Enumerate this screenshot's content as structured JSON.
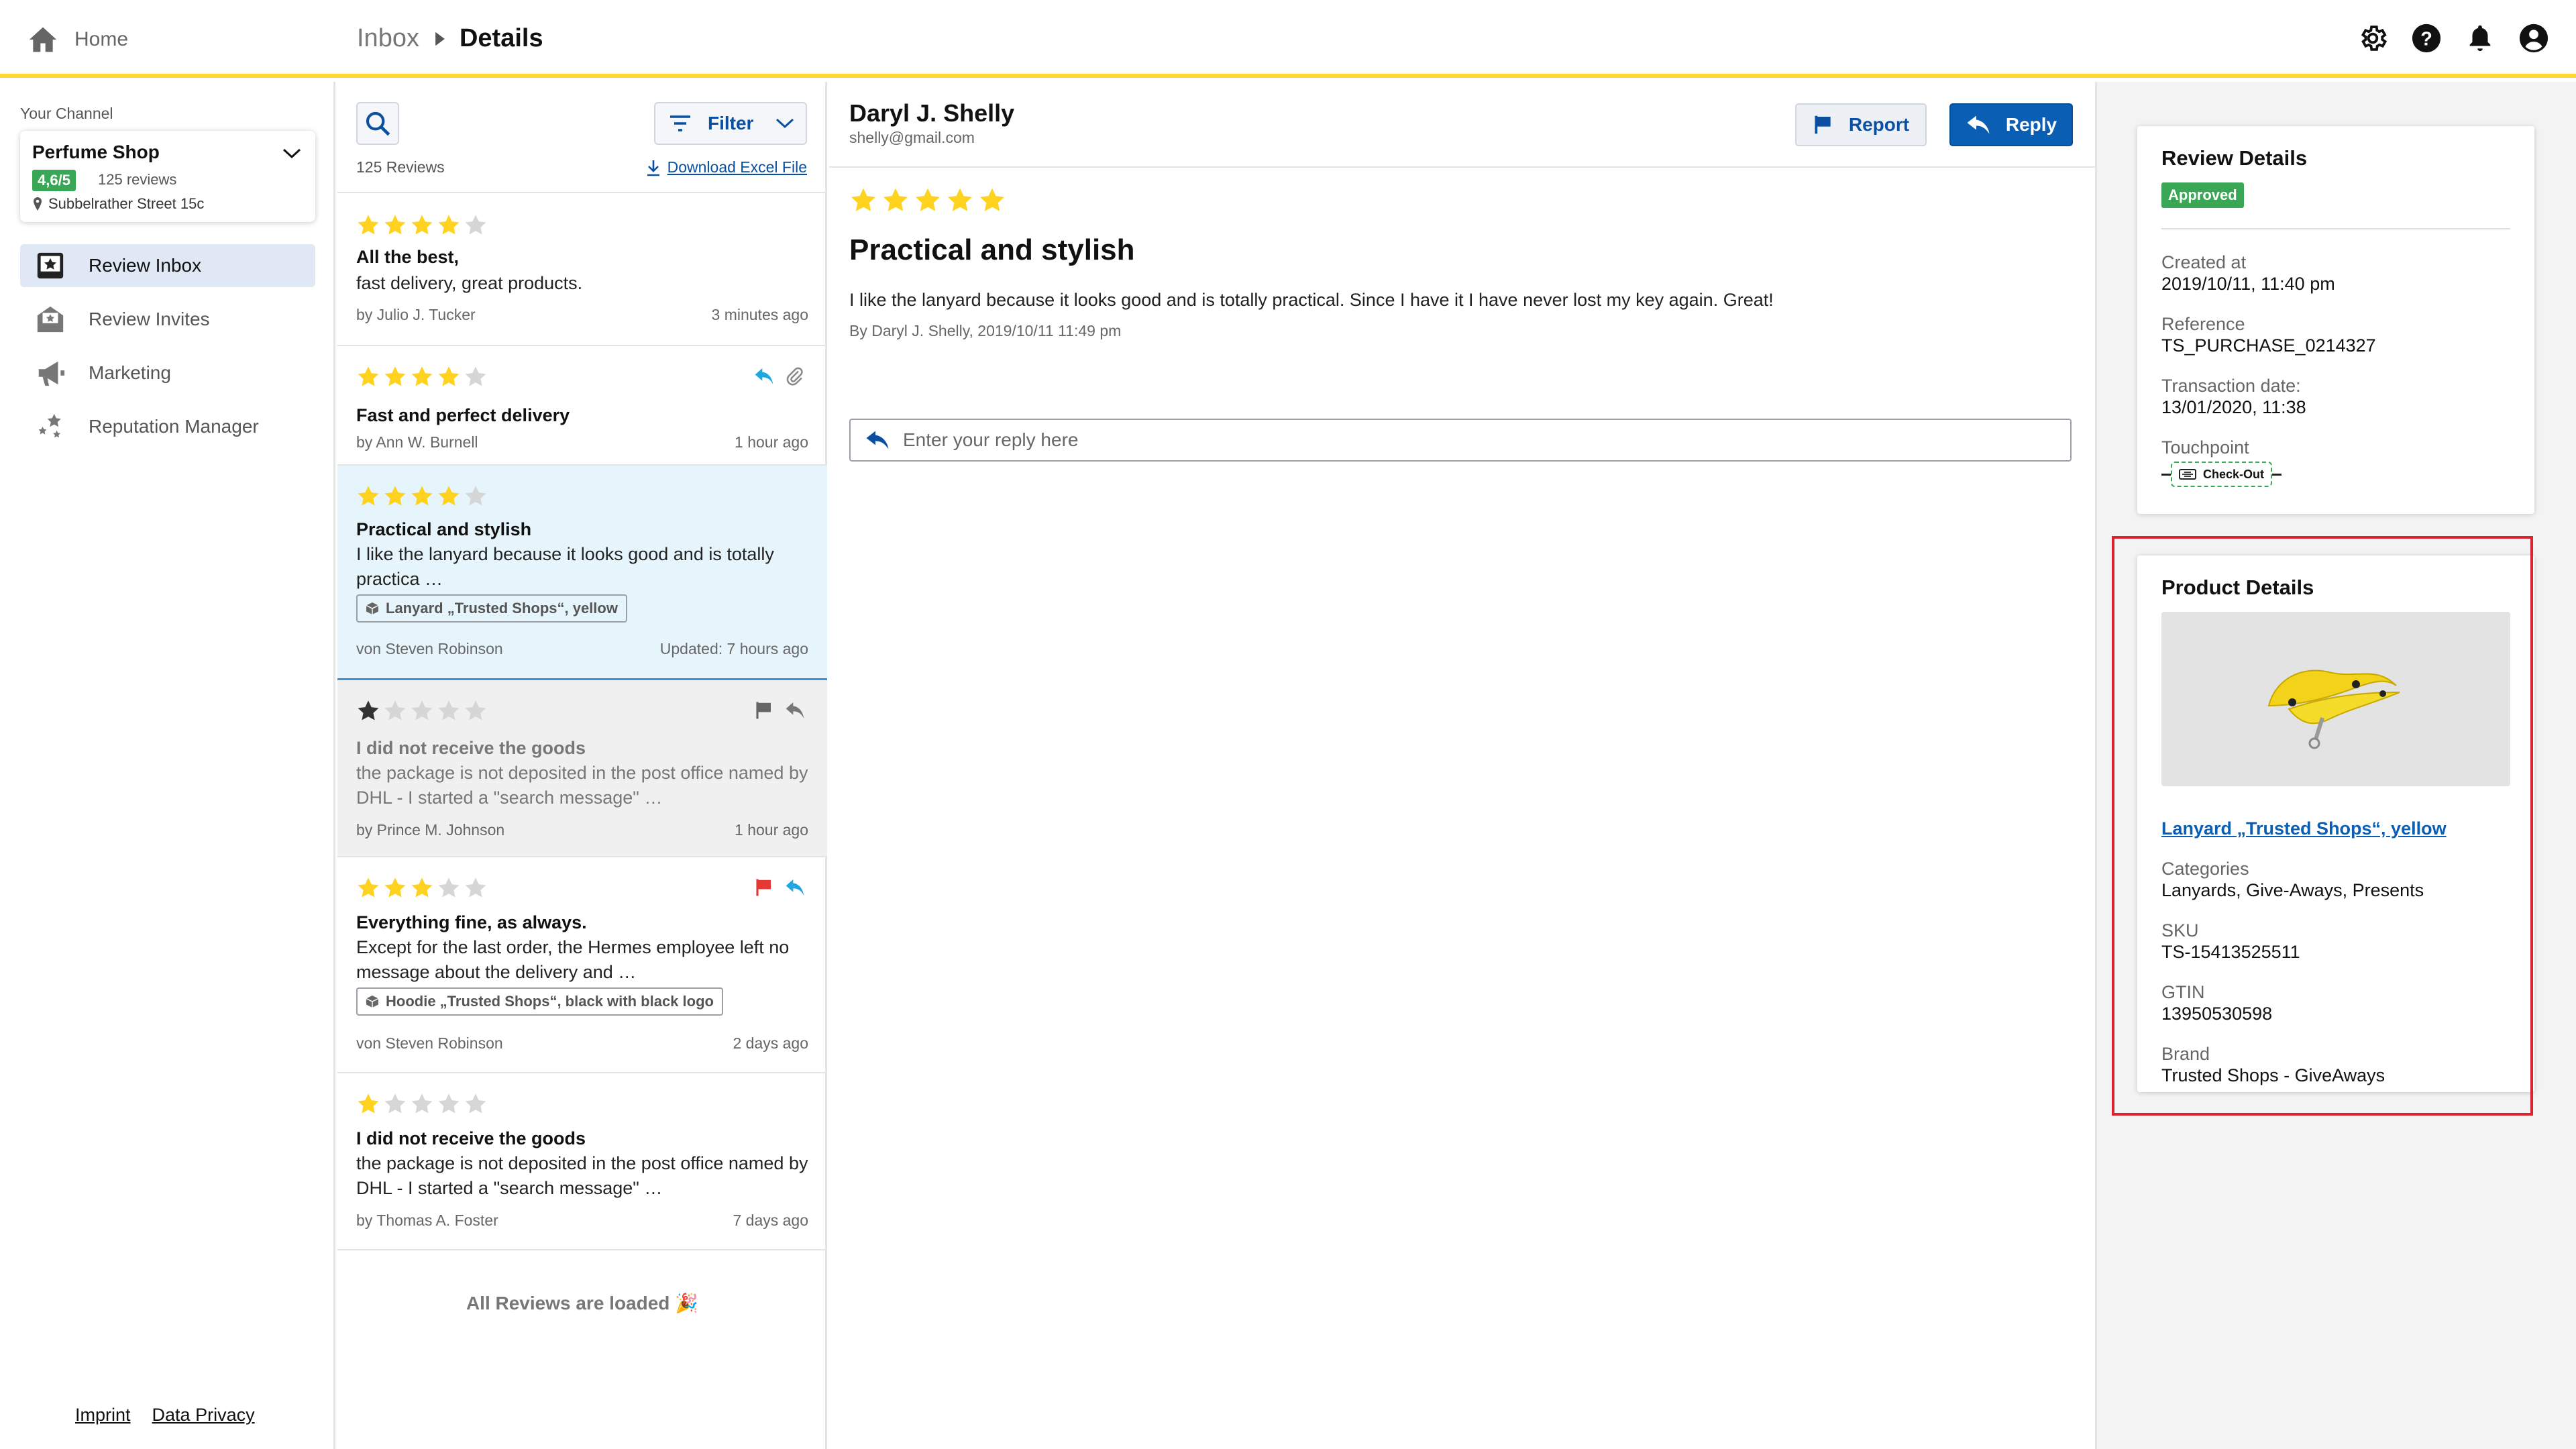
{
  "header": {
    "home_label": "Home",
    "breadcrumb": [
      "Inbox",
      "Details"
    ],
    "icons": [
      "settings-icon",
      "help-icon",
      "notifications-icon",
      "account-icon"
    ]
  },
  "sidebar": {
    "channel_label": "Your Channel",
    "channel": {
      "name": "Perfume Shop",
      "rating": "4,6/5",
      "reviews": "125 reviews",
      "address": "Subbelrather Street 15c"
    },
    "nav": [
      {
        "label": "Review Inbox",
        "icon": "inbox-star-icon",
        "active": true
      },
      {
        "label": "Review Invites",
        "icon": "invite-mail-icon",
        "active": false
      },
      {
        "label": "Marketing",
        "icon": "megaphone-icon",
        "active": false
      },
      {
        "label": "Reputation Manager",
        "icon": "stars-sparkle-icon",
        "active": false
      }
    ],
    "footer": {
      "imprint": "Imprint",
      "privacy": "Data Privacy"
    }
  },
  "list": {
    "filter_label": "Filter",
    "count": "125 Reviews",
    "download": "Download Excel File",
    "reviews": [
      {
        "stars": 4,
        "title": "All the best,",
        "body": "fast delivery, great products.",
        "author": "by Julio J. Tucker",
        "time": "3 minutes ago",
        "icons": []
      },
      {
        "stars": 4,
        "title": "Fast and perfect delivery",
        "body": "",
        "author": "by Ann W. Burnell",
        "time": "1 hour ago",
        "icons": [
          "reply-icon",
          "attachment-icon"
        ]
      },
      {
        "stars": 4,
        "title": "Practical and stylish",
        "body": "I like the lanyard because it looks good and is totally practica …",
        "product": "Lanyard „Trusted Shops“, yellow",
        "author": "von Steven Robinson",
        "time": "Updated: 7 hours ago",
        "icons": []
      },
      {
        "stars": 1,
        "title": "I did not receive the goods",
        "body": "the package is not deposited in the post office named by DHL - I started a \"search message\" …",
        "author": "by Prince M. Johnson",
        "time": "1 hour ago",
        "icons": [
          "flag-icon",
          "reply-icon"
        ]
      },
      {
        "stars": 3,
        "title": "Everything fine, as always.",
        "body": "Except for the last order, the Hermes employee left no message about the delivery and …",
        "product": "Hoodie „Trusted Shops“, black with black logo",
        "author": "von Steven Robinson",
        "time": "2 days ago",
        "icons": [
          "flag-icon",
          "reply-icon"
        ]
      },
      {
        "stars": 1,
        "title": "I did not receive the goods",
        "body": "the package is not deposited in the post office named by DHL - I started a \"search message\" …",
        "author": "by Thomas A. Foster",
        "time": "7 days ago",
        "icons": []
      }
    ],
    "all_loaded": "All Reviews are loaded 🎉"
  },
  "detail": {
    "author": "Daryl J. Shelly",
    "email": "shelly@gmail.com",
    "report_label": "Report",
    "reply_label": "Reply",
    "stars": 5,
    "title": "Practical and stylish",
    "text": "I like the lanyard because it looks good and is totally practical. Since I have it I have never lost my key again. Great!",
    "by": "By Daryl J. Shelly, 2019/10/11 11:49 pm",
    "reply_placeholder": "Enter your reply here"
  },
  "review_details": {
    "title": "Review Details",
    "status": "Approved",
    "created_label": "Created at",
    "created": "2019/10/11, 11:40 pm",
    "reference_label": "Reference",
    "reference": "TS_PURCHASE_0214327",
    "transaction_label": "Transaction date:",
    "transaction": "13/01/2020, 11:38",
    "touchpoint_label": "Touchpoint",
    "touchpoint": "Check-Out"
  },
  "product_details": {
    "title": "Product Details",
    "name": "Lanyard „Trusted Shops“, yellow",
    "categories_label": "Categories",
    "categories": "Lanyards, Give-Aways, Presents",
    "sku_label": "SKU",
    "sku": "TS-15413525511",
    "gtin_label": "GTIN",
    "gtin": "13950530598",
    "brand_label": "Brand",
    "brand": "Trusted Shops - GiveAways"
  },
  "colors": {
    "accent_yellow": "#ffd92c",
    "primary_blue": "#0a5fb4",
    "success_green": "#3aa757",
    "flag_red": "#e53935",
    "reply_cyan": "#1ea7e0",
    "highlight_red": "#d9232e"
  }
}
